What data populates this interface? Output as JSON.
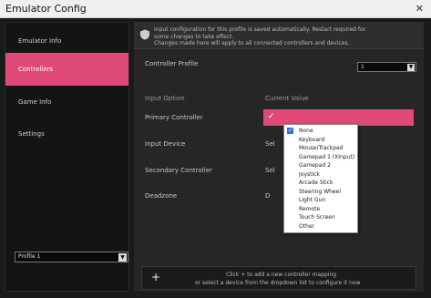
{
  "window": {
    "title": "Emulator Config",
    "close_glyph": "✕"
  },
  "sidebar": {
    "items": [
      {
        "label": "Emulator Info"
      },
      {
        "label": "Controllers"
      },
      {
        "label": "Game Info"
      },
      {
        "label": "Settings"
      }
    ],
    "select_value": "Profile 1"
  },
  "banner": {
    "line1": "Input configuration for this profile is saved automatically. Restart required for",
    "line2": "some changes to take effect.",
    "line3": "Changes made here will apply to all connected controllers and devices."
  },
  "main": {
    "top_label": "Controller Profile",
    "top_select_value": "1",
    "header_left": "Input Option",
    "header_right": "Current Value",
    "rows": [
      {
        "label": "Primary Controller",
        "value": "✓"
      },
      {
        "label": "Input Device",
        "value": "Sel"
      },
      {
        "label": "Secondary Controller",
        "value": "Sel"
      },
      {
        "label": "Deadzone",
        "value": "D"
      }
    ],
    "add_line1": "Click + to add a new controller mapping",
    "add_line2": "or select a device from the dropdown list to configure it now",
    "plus_glyph": "+"
  },
  "dropdown": {
    "items": [
      {
        "label": "None",
        "checked": true
      },
      {
        "label": "Keyboard",
        "checked": false
      },
      {
        "label": "Mouse/Trackpad",
        "checked": false
      },
      {
        "label": "Gamepad 1 (XInput)",
        "checked": false
      },
      {
        "label": "Gamepad 2",
        "checked": false
      },
      {
        "label": "Joystick",
        "checked": false
      },
      {
        "label": "Arcade Stick",
        "checked": false
      },
      {
        "label": "Steering Wheel",
        "checked": false
      },
      {
        "label": "Light Gun",
        "checked": false
      },
      {
        "label": "Remote",
        "checked": false
      },
      {
        "label": "Touch Screen",
        "checked": false
      },
      {
        "label": "Other",
        "checked": false
      }
    ]
  },
  "colors": {
    "accent": "#e04a78",
    "check": "#3a6fd1"
  }
}
